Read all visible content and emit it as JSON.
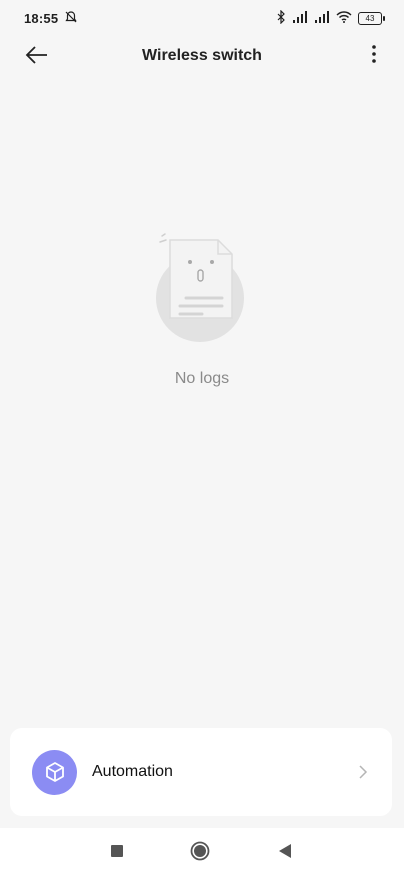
{
  "status_bar": {
    "time": "18:55",
    "battery": "43",
    "icons": [
      "bell-off-icon",
      "bluetooth-icon",
      "signal-icon",
      "signal-icon",
      "wifi-icon",
      "battery-icon"
    ]
  },
  "app_bar": {
    "title": "Wireless switch",
    "back_icon": "arrow-left-icon",
    "more_icon": "more-vertical-icon"
  },
  "empty_state": {
    "message": "No logs",
    "icon": "document-face-icon"
  },
  "automation_card": {
    "label": "Automation",
    "icon": "cube-icon",
    "accent_color": "#8b8cf3",
    "chevron_icon": "chevron-right-icon"
  },
  "nav_bar": {
    "icons": [
      "square-icon",
      "home-circle-icon",
      "back-triangle-icon"
    ]
  }
}
